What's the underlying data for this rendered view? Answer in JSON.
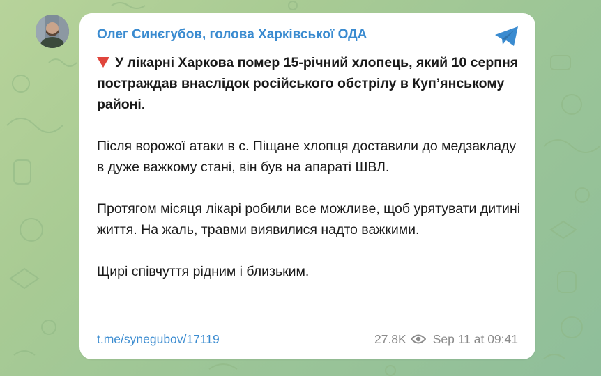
{
  "channel": {
    "name": "Олег Синєгубов, голова Харківської ОДА"
  },
  "post": {
    "headline": "У лікарні Харкова помер 15-річний хлопець, який 10 серпня постраждав внаслідок російського обстрілу в Куп’янському районі.",
    "paragraphs": [
      "Після ворожої атаки в с. Піщане хлопця доставили до медзакладу в дуже важкому стані, він був на апараті ШВЛ.",
      "Протягом місяця лікарі робили все можливе, щоб урятувати дитині життя. На жаль, травми виявилися надто важкими.",
      "Щирі співчуття рідним і близьким."
    ],
    "link": "t.me/synegubov/17119",
    "views": "27.8K",
    "timestamp": "Sep 11 at 09:41"
  },
  "icons": {
    "headline_marker": "red-triangle-down-icon",
    "app": "telegram-icon",
    "views": "eye-icon"
  },
  "colors": {
    "accent": "#3a8bd0",
    "marker": "#e0453c",
    "background": "#a9cb94"
  }
}
